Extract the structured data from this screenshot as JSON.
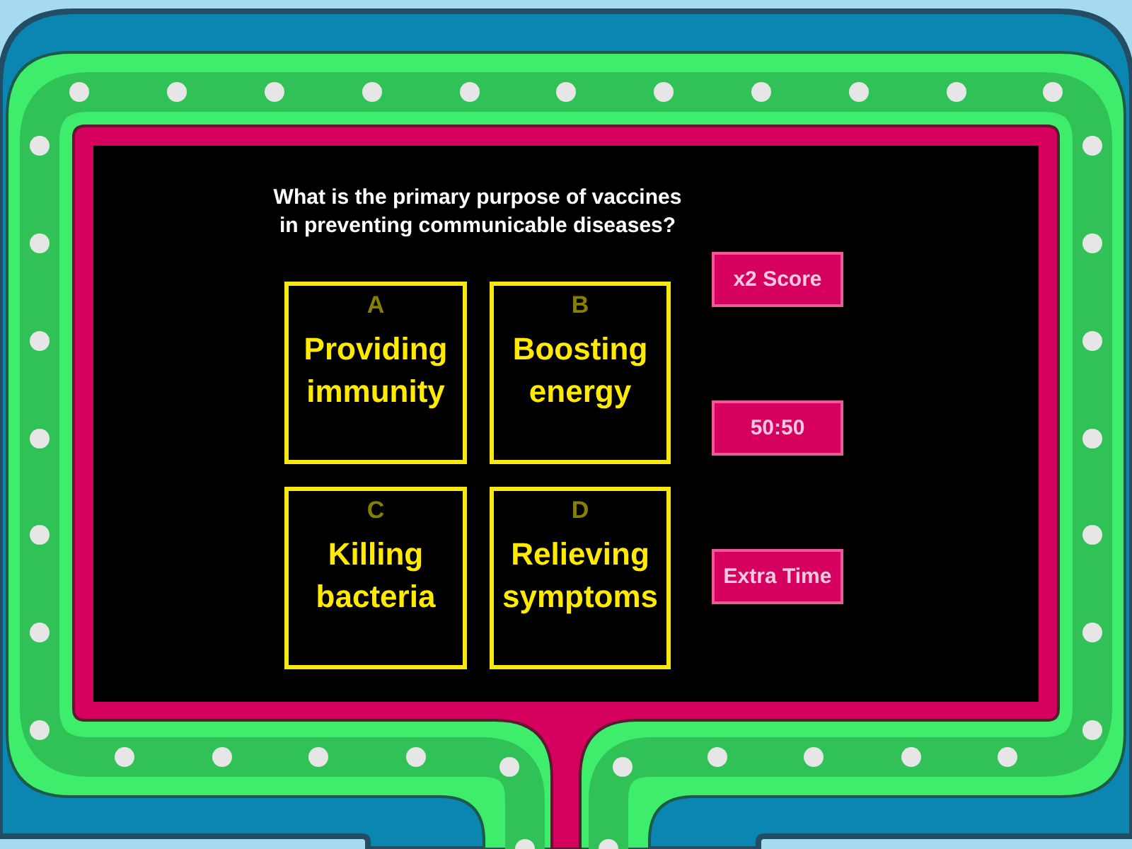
{
  "question": "What is the primary purpose of vaccines in preventing communicable diseases?",
  "answers": [
    {
      "letter": "A",
      "text": "Providing immunity"
    },
    {
      "letter": "B",
      "text": "Boosting energy"
    },
    {
      "letter": "C",
      "text": "Killing bacteria"
    },
    {
      "letter": "D",
      "text": "Relieving symptoms"
    }
  ],
  "power_ups": [
    {
      "label": "x2 Score"
    },
    {
      "label": "50:50"
    },
    {
      "label": "Extra Time"
    }
  ]
}
